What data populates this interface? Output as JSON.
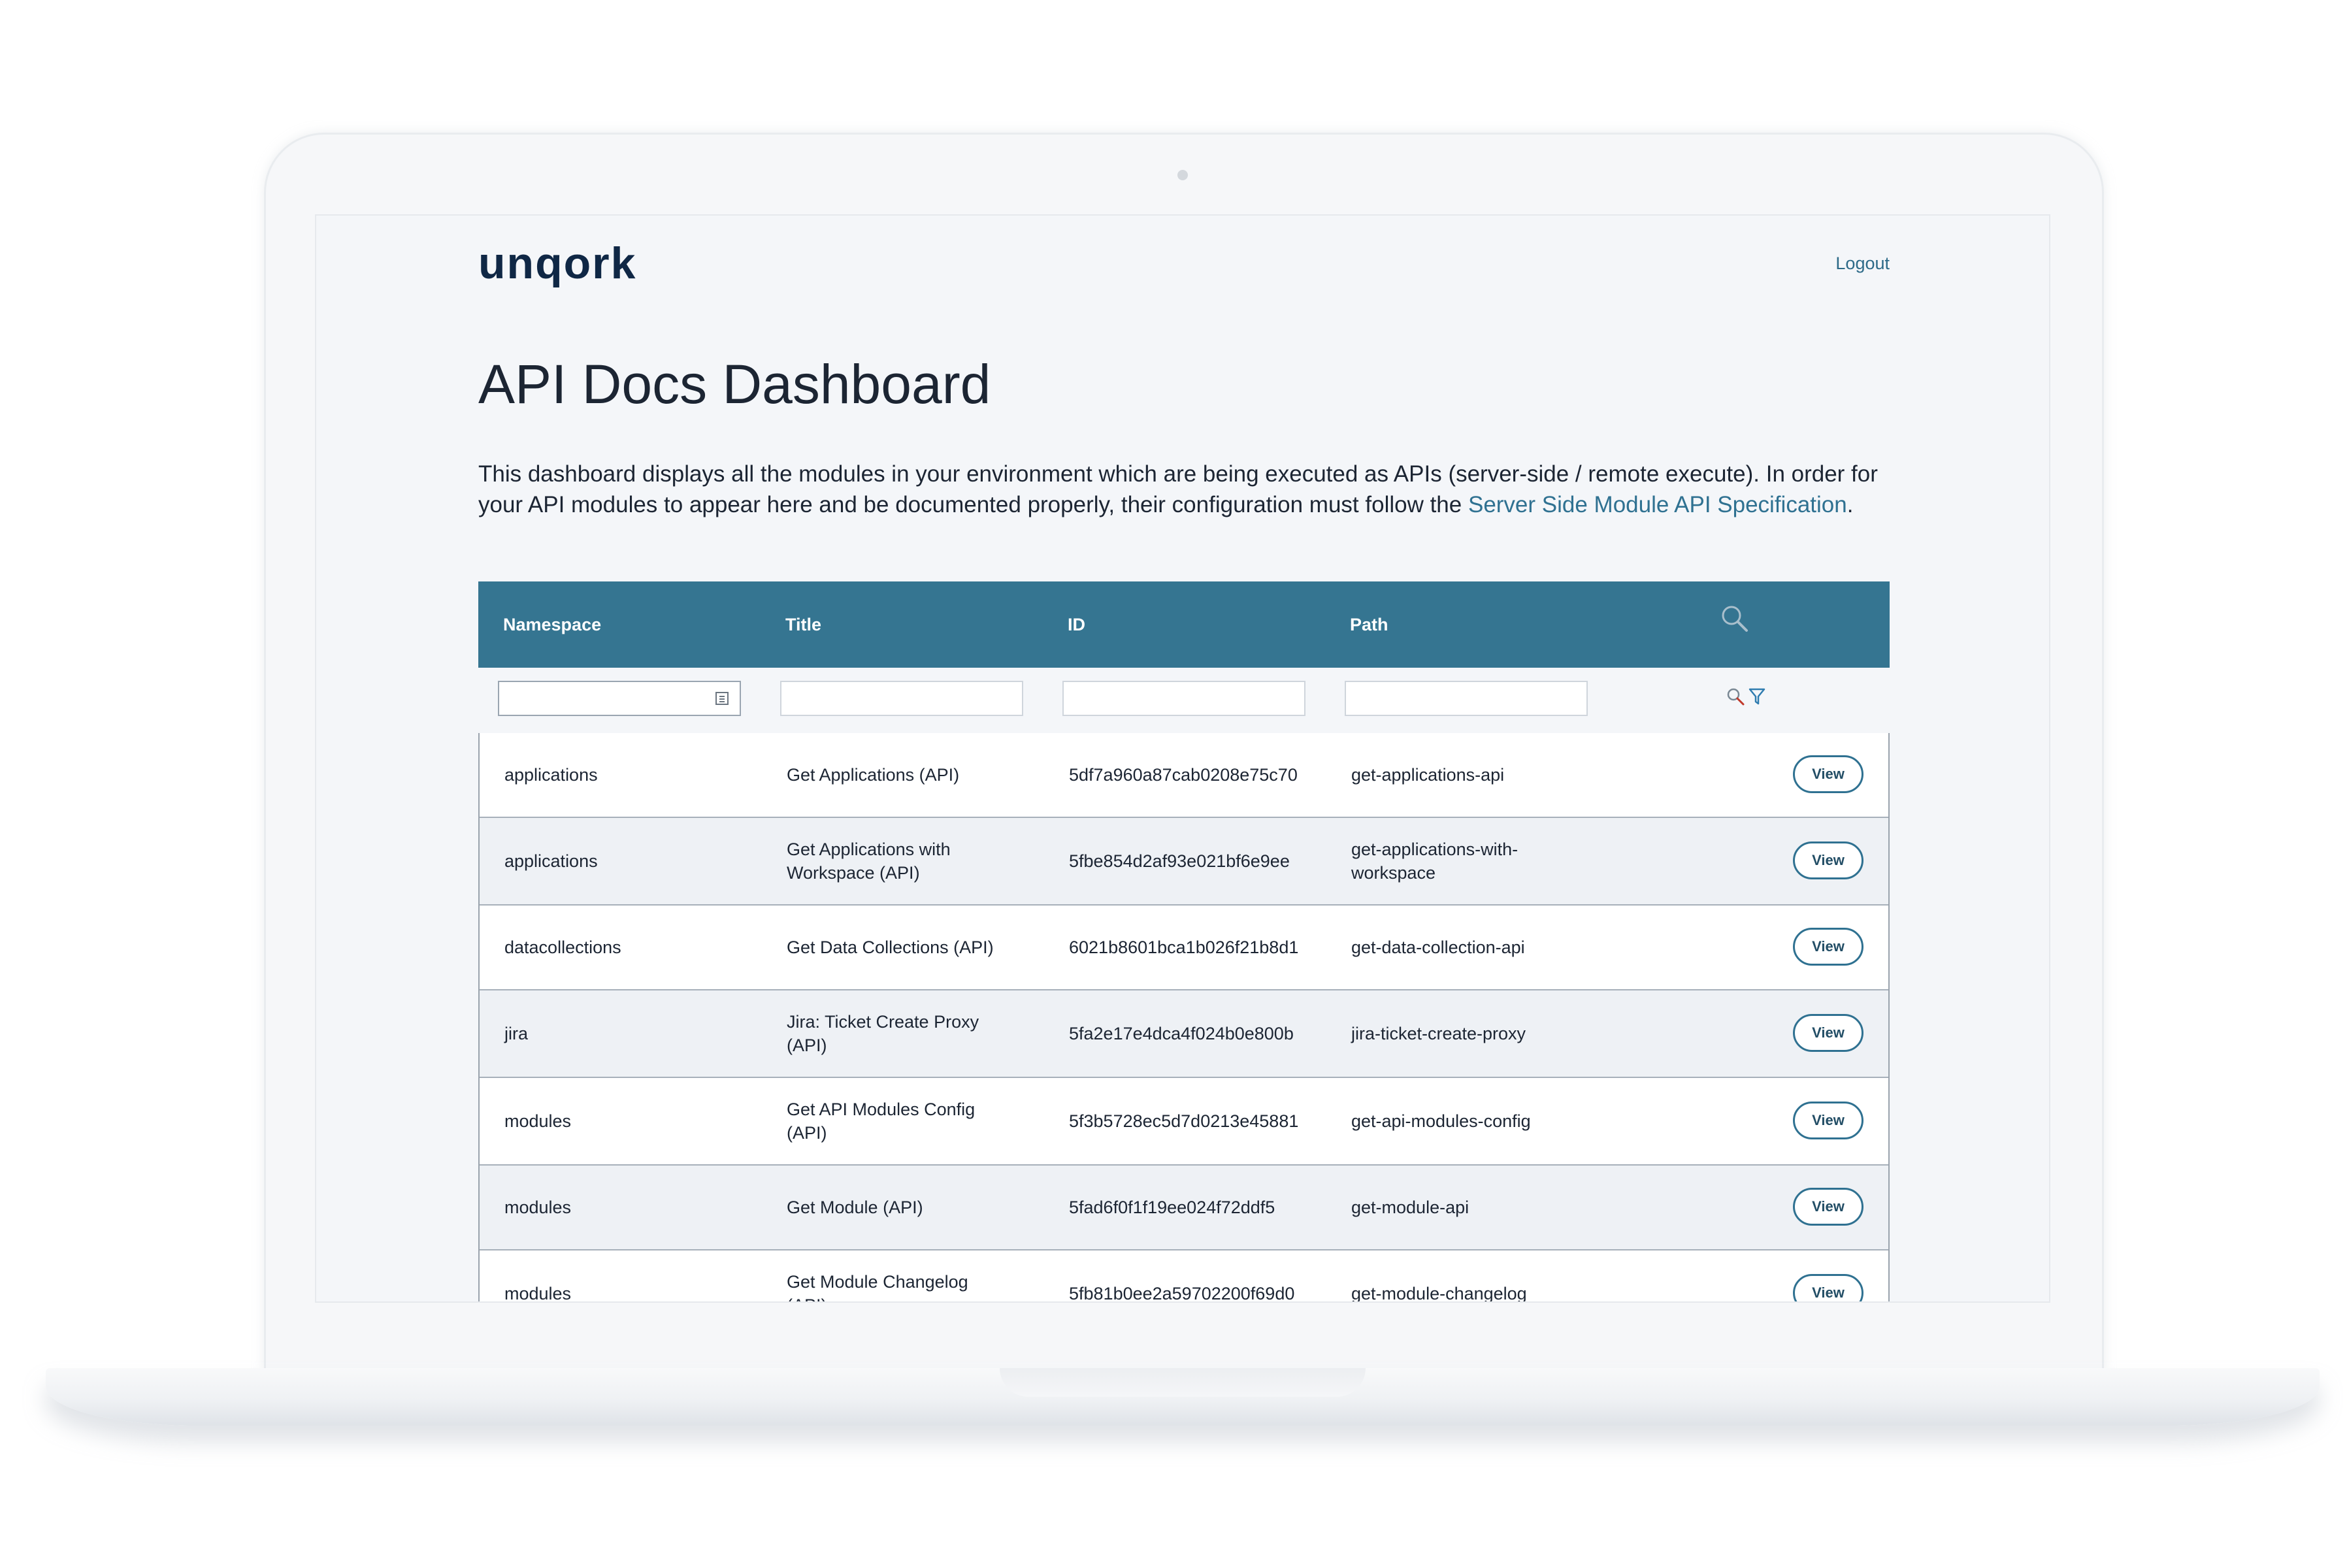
{
  "header": {
    "logo_text": "unqork",
    "logout_label": "Logout"
  },
  "page": {
    "title": "API Docs Dashboard",
    "description": "This dashboard displays all the modules in your environment which are being executed as APIs (server-side / remote execute). In order for your API modules to appear here and be documented properly, their configuration must follow the ",
    "spec_link_text": "Server Side Module API Specification",
    "description_end": "."
  },
  "table": {
    "columns": {
      "namespace": "Namespace",
      "title": "Title",
      "id": "ID",
      "path": "Path"
    },
    "view_label": "View",
    "rows": [
      {
        "namespace": "applications",
        "title": "Get Applications (API)",
        "id": "5df7a960a87cab0208e75c70",
        "path": "get-applications-api"
      },
      {
        "namespace": "applications",
        "title": "Get Applications with Workspace (API)",
        "id": "5fbe854d2af93e021bf6e9ee",
        "path": "get-applications-with-workspace"
      },
      {
        "namespace": "datacollections",
        "title": "Get Data Collections (API)",
        "id": "6021b8601bca1b026f21b8d1",
        "path": "get-data-collection-api"
      },
      {
        "namespace": "jira",
        "title": "Jira: Ticket Create Proxy (API)",
        "id": "5fa2e17e4dca4f024b0e800b",
        "path": "jira-ticket-create-proxy"
      },
      {
        "namespace": "modules",
        "title": "Get API Modules Config (API)",
        "id": "5f3b5728ec5d7d0213e45881",
        "path": "get-api-modules-config"
      },
      {
        "namespace": "modules",
        "title": "Get Module (API)",
        "id": "5fad6f0f1f19ee024f72ddf5",
        "path": "get-module-api"
      },
      {
        "namespace": "modules",
        "title": "Get Module Changelog (API)",
        "id": "5fb81b0ee2a59702200f69d0",
        "path": "get-module-changelog"
      }
    ]
  },
  "colors": {
    "header_bg": "#357591",
    "link": "#2f7191",
    "logo": "#0f2745"
  }
}
